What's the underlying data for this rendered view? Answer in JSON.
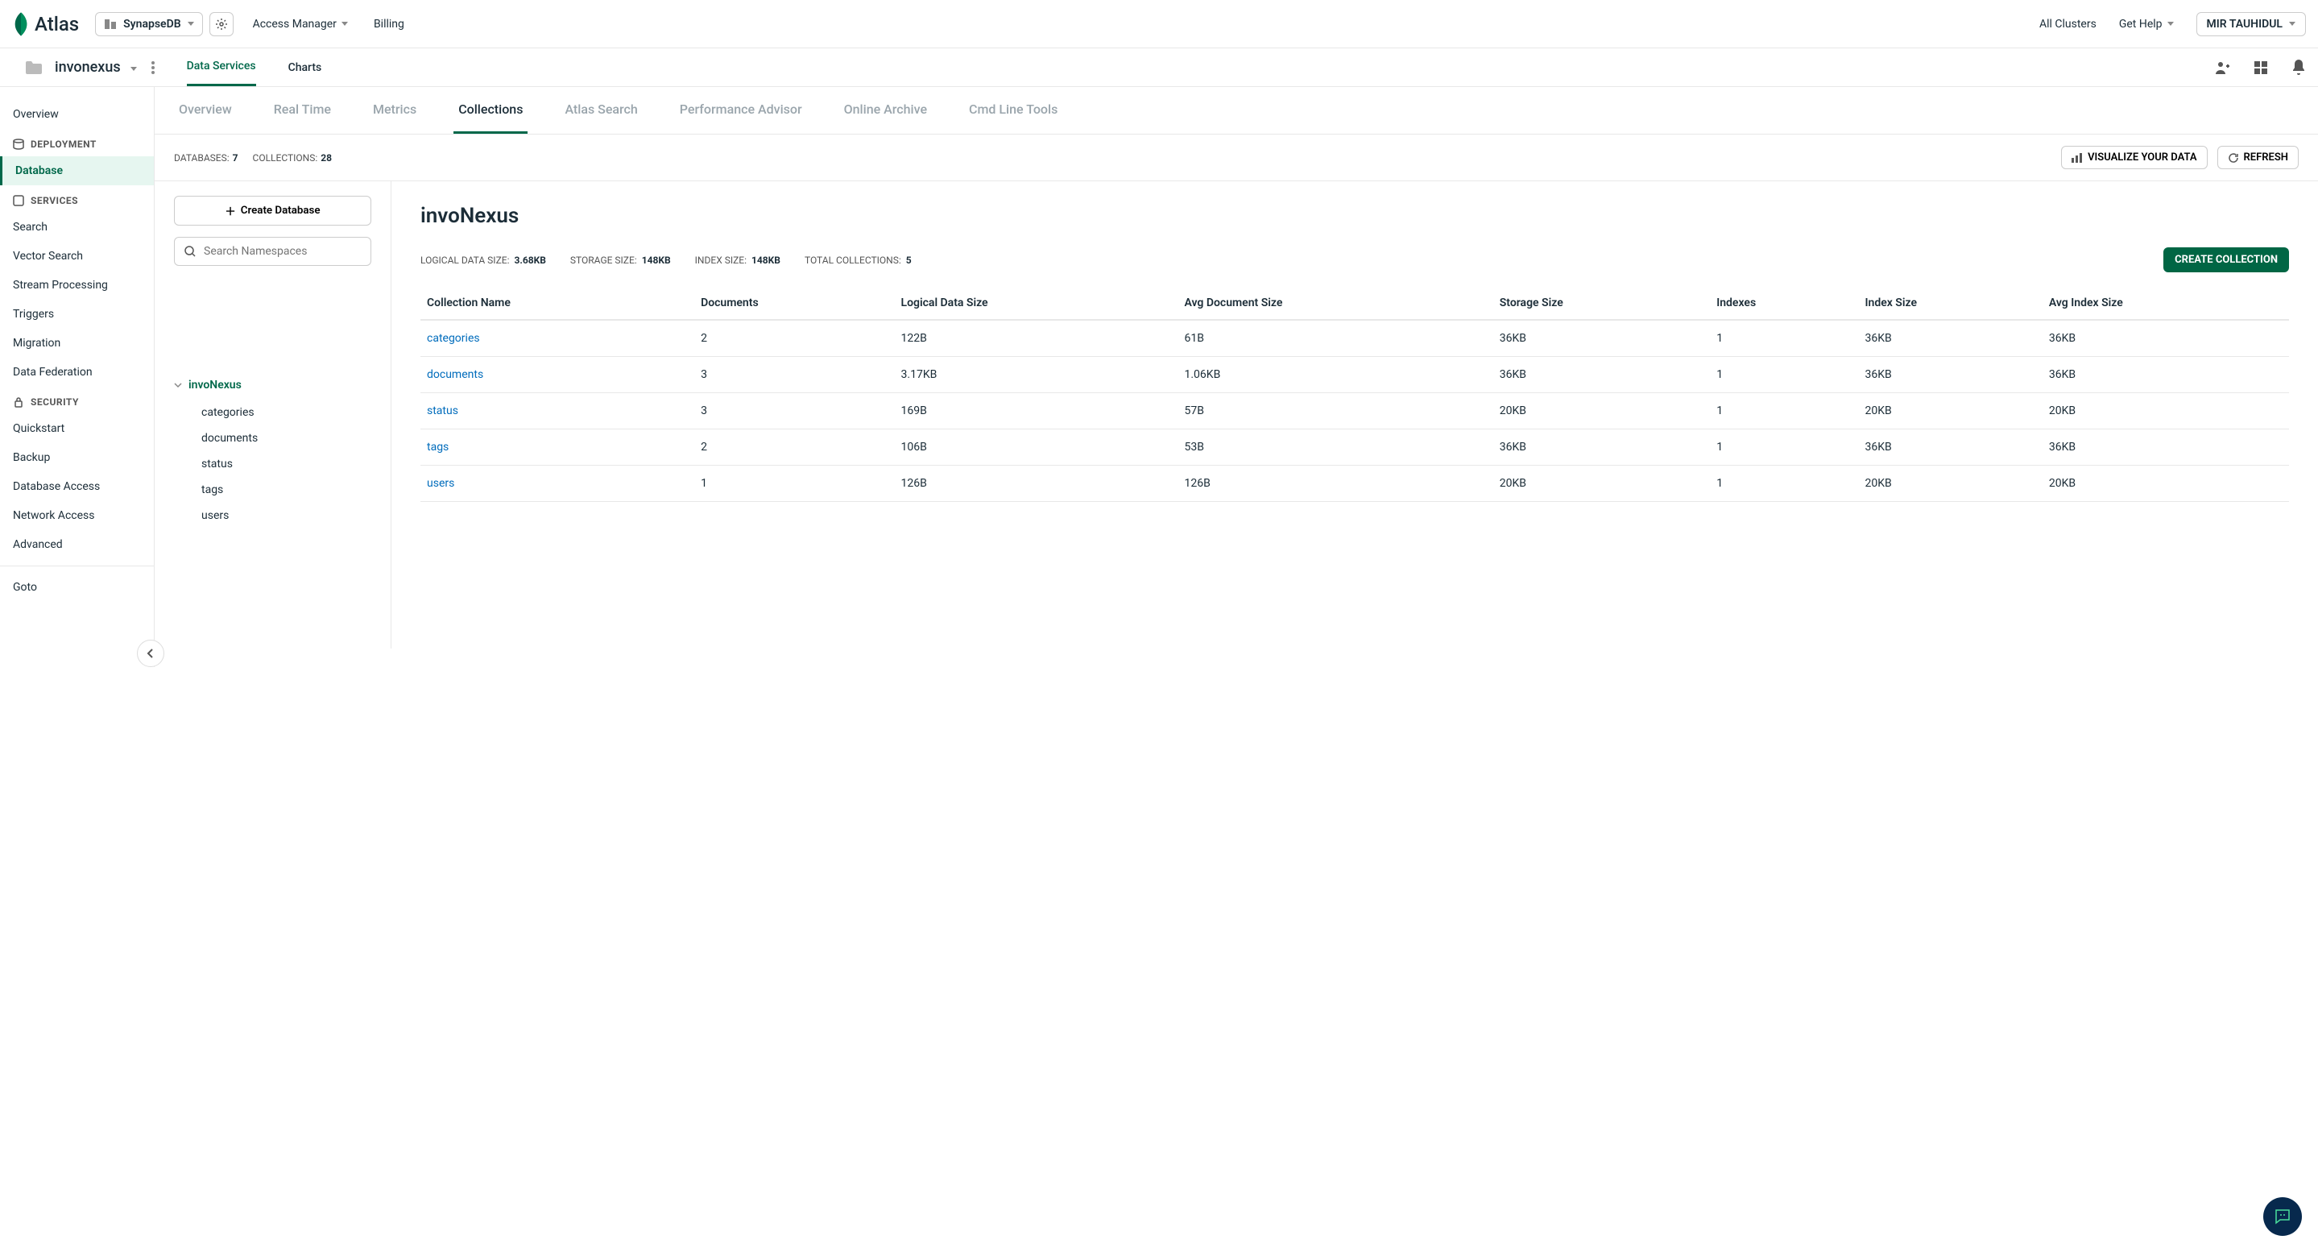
{
  "brand": "Atlas",
  "topbar": {
    "project": "SynapseDB",
    "access_manager": "Access Manager",
    "billing": "Billing",
    "all_clusters": "All Clusters",
    "get_help": "Get Help",
    "user": "MIR TAUHIDUL"
  },
  "navbar": {
    "project": "invonexus",
    "tabs": {
      "data_services": "Data Services",
      "charts": "Charts"
    }
  },
  "sidebar": {
    "overview": "Overview",
    "deployment_head": "DEPLOYMENT",
    "database": "Database",
    "services_head": "SERVICES",
    "search": "Search",
    "vector_search": "Vector Search",
    "stream_processing": "Stream Processing",
    "triggers": "Triggers",
    "migration": "Migration",
    "data_federation": "Data Federation",
    "security_head": "SECURITY",
    "quickstart": "Quickstart",
    "backup": "Backup",
    "database_access": "Database Access",
    "network_access": "Network Access",
    "advanced": "Advanced",
    "goto": "Goto"
  },
  "cluster_tabs": {
    "overview": "Overview",
    "real_time": "Real Time",
    "metrics": "Metrics",
    "collections": "Collections",
    "atlas_search": "Atlas Search",
    "performance_advisor": "Performance Advisor",
    "online_archive": "Online Archive",
    "cmd_line_tools": "Cmd Line Tools"
  },
  "stats": {
    "databases_label": "DATABASES:",
    "databases_value": "7",
    "collections_label": "COLLECTIONS:",
    "collections_value": "28",
    "visualize": "VISUALIZE YOUR DATA",
    "refresh": "REFRESH"
  },
  "db_panel": {
    "create": "Create Database",
    "search_placeholder": "Search Namespaces",
    "db_name": "invoNexus",
    "items": {
      "categories": "categories",
      "documents": "documents",
      "status": "status",
      "tags": "tags",
      "users": "users"
    }
  },
  "detail": {
    "title": "invoNexus",
    "logical_label": "LOGICAL DATA SIZE:",
    "logical_value": "3.68KB",
    "storage_label": "STORAGE SIZE:",
    "storage_value": "148KB",
    "index_label": "INDEX SIZE:",
    "index_value": "148KB",
    "total_label": "TOTAL COLLECTIONS:",
    "total_value": "5",
    "create_collection": "CREATE COLLECTION",
    "headers": {
      "name": "Collection Name",
      "docs": "Documents",
      "logical": "Logical Data Size",
      "avgdoc": "Avg Document Size",
      "storage": "Storage Size",
      "indexes": "Indexes",
      "indexsize": "Index Size",
      "avgindex": "Avg Index Size"
    },
    "rows": [
      {
        "name": "categories",
        "docs": "2",
        "logical": "122B",
        "avgdoc": "61B",
        "storage": "36KB",
        "indexes": "1",
        "indexsize": "36KB",
        "avgindex": "36KB"
      },
      {
        "name": "documents",
        "docs": "3",
        "logical": "3.17KB",
        "avgdoc": "1.06KB",
        "storage": "36KB",
        "indexes": "1",
        "indexsize": "36KB",
        "avgindex": "36KB"
      },
      {
        "name": "status",
        "docs": "3",
        "logical": "169B",
        "avgdoc": "57B",
        "storage": "20KB",
        "indexes": "1",
        "indexsize": "20KB",
        "avgindex": "20KB"
      },
      {
        "name": "tags",
        "docs": "2",
        "logical": "106B",
        "avgdoc": "53B",
        "storage": "36KB",
        "indexes": "1",
        "indexsize": "36KB",
        "avgindex": "36KB"
      },
      {
        "name": "users",
        "docs": "1",
        "logical": "126B",
        "avgdoc": "126B",
        "storage": "20KB",
        "indexes": "1",
        "indexsize": "20KB",
        "avgindex": "20KB"
      }
    ]
  }
}
